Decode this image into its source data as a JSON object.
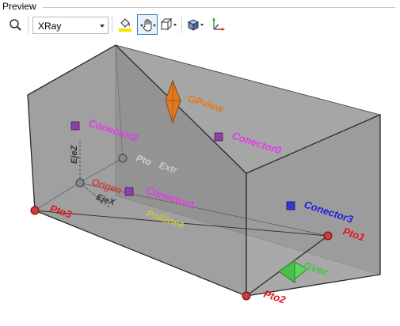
{
  "panel": {
    "title": "Preview"
  },
  "toolbar": {
    "render_mode": "XRay",
    "buttons": [
      {
        "name": "zoom-icon"
      },
      {
        "name": "render-mode-dropdown"
      },
      {
        "name": "paint-bucket-icon"
      },
      {
        "name": "pan-hand-icon"
      },
      {
        "name": "view-cube-icon"
      },
      {
        "name": "shading-icon"
      },
      {
        "name": "axes-icon"
      }
    ]
  },
  "scene": {
    "labels": {
      "gpview": "GPview",
      "conector0": "Conector0",
      "conector1": "Conector1",
      "conector2": "Conector2",
      "conector3": "Conector3",
      "pto1": "Pto1",
      "pto2": "Pto2",
      "pto3": "Pto3",
      "pto": "Pto",
      "extr": "Extr",
      "origen": "Origen",
      "ejex": "EjeX",
      "ejez": "EjeZ",
      "polilinea": "Polilinea",
      "gvec": "GVec"
    },
    "colors": {
      "box_fill": "#8f8f8f",
      "edge": "#2a2a2a",
      "point": "#cc3a3a",
      "gpview": "#e07a22",
      "gvec": "#48c048",
      "magenta": "#e23ce8",
      "blue": "#1f1ee0",
      "red": "#e0181e",
      "grey_text": "#c8c8c8",
      "yellow_text": "#c9c93a"
    }
  }
}
